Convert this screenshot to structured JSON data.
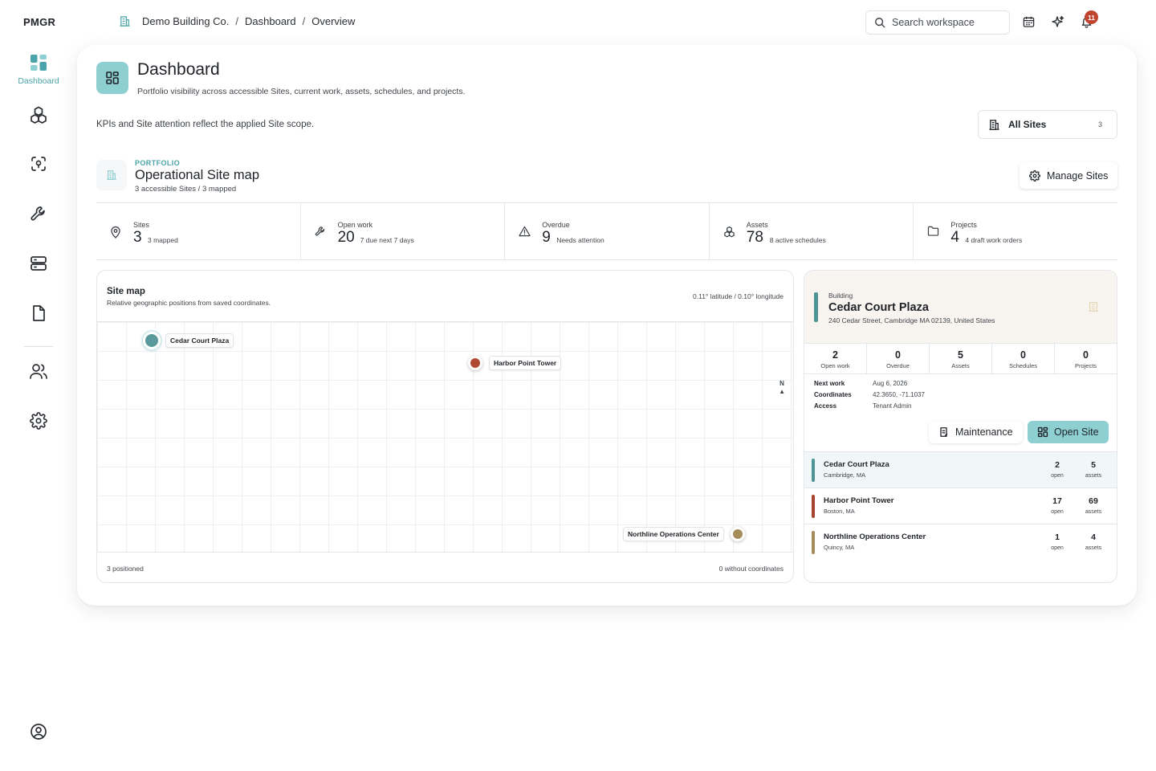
{
  "app": {
    "brand": "PMGR"
  },
  "breadcrumb": [
    "Demo Building Co.",
    "Dashboard",
    "Overview"
  ],
  "sidebar": {
    "active_label": "Dashboard",
    "items": [
      "dashboard",
      "assets",
      "locations",
      "maintenance",
      "storage",
      "documents",
      "people",
      "settings",
      "account"
    ]
  },
  "topbar": {
    "search_placeholder": "Search workspace",
    "notification_count": "11"
  },
  "page": {
    "title": "Dashboard",
    "subtitle": "Portfolio visibility across accessible Sites, current work, assets, schedules, and projects.",
    "scope_note": "KPIs and Site attention reflect the applied Site scope.",
    "site_filter": {
      "label": "All Sites",
      "count": "3"
    }
  },
  "portfolio": {
    "eyebrow": "PORTFOLIO",
    "title": "Operational Site map",
    "subtitle": "3 accessible Sites / 3 mapped",
    "manage_button": "Manage Sites"
  },
  "kpis": [
    {
      "label": "Sites",
      "value": "3",
      "note": "3 mapped",
      "icon": "location-pin-icon"
    },
    {
      "label": "Open work",
      "value": "20",
      "note": "7 due next 7 days",
      "icon": "wrench-icon"
    },
    {
      "label": "Overdue",
      "value": "9",
      "note": "Needs attention",
      "icon": "warning-icon"
    },
    {
      "label": "Assets",
      "value": "78",
      "note": "8 active schedules",
      "icon": "assets-icon"
    },
    {
      "label": "Projects",
      "value": "4",
      "note": "4 draft work orders",
      "icon": "folder-icon"
    }
  ],
  "map": {
    "title": "Site map",
    "subtitle": "Relative geographic positions from saved coordinates.",
    "scale": "0.11° latitude / 0.10° longitude",
    "north": "N",
    "footer_left": "3 positioned",
    "footer_right": "0 without coordinates",
    "pins": [
      {
        "name": "Cedar Court Plaza",
        "color": "#5a9a9c",
        "lat": 42.365,
        "lng": -71.1037,
        "selected": true
      },
      {
        "name": "Harbor Point Tower",
        "color": "#b04a35",
        "selected": false
      },
      {
        "name": "Northline Operations Center",
        "color": "#a68b5b",
        "selected": false
      }
    ]
  },
  "detail": {
    "eyebrow": "Building",
    "title": "Cedar Court Plaza",
    "address": "240 Cedar Street, Cambridge MA 02139, United States",
    "accent": "#4f9494",
    "stats": [
      {
        "value": "2",
        "label": "Open work"
      },
      {
        "value": "0",
        "label": "Overdue"
      },
      {
        "value": "5",
        "label": "Assets"
      },
      {
        "value": "0",
        "label": "Schedules"
      },
      {
        "value": "0",
        "label": "Projects"
      }
    ],
    "fields": [
      {
        "key": "Next work",
        "value": "Aug 6, 2026"
      },
      {
        "key": "Coordinates",
        "value": "42.3650, -71.1037"
      },
      {
        "key": "Access",
        "value": "Tenant Admin"
      }
    ],
    "maintenance_button": "Maintenance",
    "open_button": "Open Site"
  },
  "site_list": [
    {
      "name": "Cedar Court Plaza",
      "location": "Cambridge, MA",
      "open": "2",
      "open_label": "open",
      "assets": "5",
      "assets_label": "assets",
      "color": "#4f9494",
      "active": true
    },
    {
      "name": "Harbor Point Tower",
      "location": "Boston, MA",
      "open": "17",
      "open_label": "open",
      "assets": "69",
      "assets_label": "assets",
      "color": "#a8432f",
      "active": false
    },
    {
      "name": "Northline Operations Center",
      "location": "Quincy, MA",
      "open": "1",
      "open_label": "open",
      "assets": "4",
      "assets_label": "assets",
      "color": "#a68b5b",
      "active": false
    }
  ]
}
